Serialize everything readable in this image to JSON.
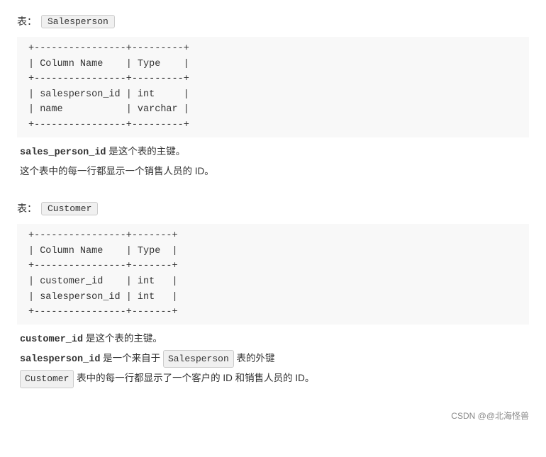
{
  "sections": [
    {
      "id": "salesperson",
      "label_prefix": "表：",
      "table_name": "Salesperson",
      "table_ascii": "+----------------+---------+\n| Column Name    | Type    |\n+----------------+---------+\n| salesperson_id | int     |\n| name           | varchar |\n+----------------+---------+",
      "descriptions": [
        {
          "type": "text_with_bold",
          "parts": [
            {
              "bold": true,
              "text": "sales_person_id"
            },
            {
              "bold": false,
              "text": " 是这个表的主键。"
            }
          ]
        },
        {
          "type": "plain",
          "text": "这个表中的每一行都显示一个销售人员的 ID。"
        }
      ]
    },
    {
      "id": "customer",
      "label_prefix": "表：",
      "table_name": "Customer",
      "table_ascii": "+----------------+-------+\n| Column Name    | Type  |\n+----------------+-------+\n| customer_id    | int   |\n| salesperson_id | int   |\n+----------------+-------+",
      "descriptions": [
        {
          "type": "text_with_bold",
          "parts": [
            {
              "bold": true,
              "text": "customer_id"
            },
            {
              "bold": false,
              "text": " 是这个表的主键。"
            }
          ]
        },
        {
          "type": "text_with_badge",
          "parts": [
            {
              "bold": true,
              "text": "salesperson_id"
            },
            {
              "bold": false,
              "text": " 是一个来自于 "
            },
            {
              "badge": true,
              "text": "Salesperson"
            },
            {
              "bold": false,
              "text": " 表的外键"
            }
          ]
        },
        {
          "type": "text_with_bold",
          "parts": [
            {
              "bold": false,
              "text": "Customer"
            },
            {
              "bold": false,
              "text": " 表中的每一行都显示了一个客户的 ID 和销售人员的 ID。"
            }
          ]
        }
      ]
    }
  ],
  "watermark": "CSDN @@北海怪兽"
}
